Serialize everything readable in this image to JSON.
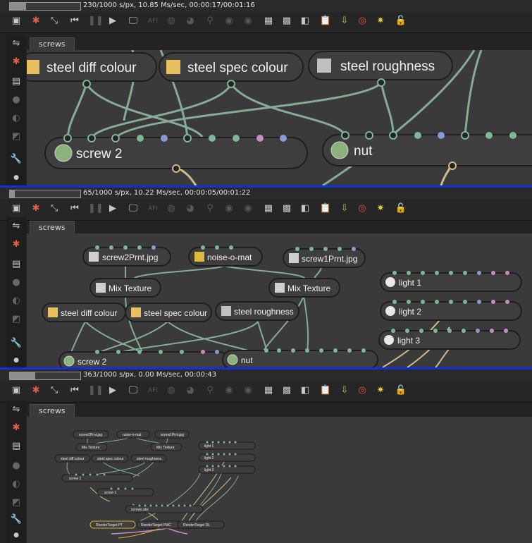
{
  "panels": [
    {
      "status": {
        "progress": 0.23,
        "text": "230/1000 s/px, 10.85 Ms/sec, 00:00:17/00:01:16"
      },
      "tab": "screws",
      "nodes": [
        {
          "label": "steel diff colour",
          "icon": "texture-colour-icon"
        },
        {
          "label": "steel spec colour",
          "icon": "texture-colour-icon"
        },
        {
          "label": "steel roughness",
          "icon": "texture-greyscale-icon"
        },
        {
          "label": "screw 2",
          "icon": "mesh-sphere-icon"
        },
        {
          "label": "nut",
          "icon": "mesh-sphere-icon"
        }
      ]
    },
    {
      "status": {
        "progress": 0.065,
        "text": "65/1000 s/px, 10.22 Ms/sec, 00:00:05/00:01:22"
      },
      "tab": "screws",
      "nodes": [
        {
          "label": "screw2Prnt.jpg",
          "icon": "image-file-icon"
        },
        {
          "label": "noise-o-mat",
          "icon": "noise-warning-icon"
        },
        {
          "label": "screw1Prnt.jpg",
          "icon": "image-file-icon"
        },
        {
          "label": "Mix Texture",
          "icon": "mix-texture-icon"
        },
        {
          "label": "Mix Texture",
          "icon": "mix-texture-icon"
        },
        {
          "label": "steel diff colour",
          "icon": "texture-colour-icon"
        },
        {
          "label": "steel spec colour",
          "icon": "texture-colour-icon"
        },
        {
          "label": "steel roughness",
          "icon": "texture-greyscale-icon"
        },
        {
          "label": "screw 2",
          "icon": "mesh-sphere-icon"
        },
        {
          "label": "nut",
          "icon": "mesh-sphere-icon"
        },
        {
          "label": "light 1",
          "icon": "light-icon"
        },
        {
          "label": "light 2",
          "icon": "light-icon"
        },
        {
          "label": "light 3",
          "icon": "light-icon"
        }
      ]
    },
    {
      "status": {
        "progress": 0.363,
        "text": "363/1000 s/px, 0.00 Ms/sec, 00:00:43"
      },
      "tab": "screws",
      "nodes": [
        {
          "label": "screw2Prnt.jpg"
        },
        {
          "label": "noise-o-mat"
        },
        {
          "label": "screw1Prnt.jpg"
        },
        {
          "label": "Mix Texture"
        },
        {
          "label": "Mix Texture"
        },
        {
          "label": "steel diff colour"
        },
        {
          "label": "steel spec colour"
        },
        {
          "label": "steel roughness"
        },
        {
          "label": "screw 2"
        },
        {
          "label": "screw 1"
        },
        {
          "label": "light 1"
        },
        {
          "label": "light 2"
        },
        {
          "label": "light 3"
        },
        {
          "label": "screws.abc"
        },
        {
          "label": "RenderTarget PT"
        },
        {
          "label": "RenderTarget PMC"
        },
        {
          "label": "RenderTarget DL"
        }
      ]
    }
  ],
  "colors": {
    "wire": "#8fb8a0",
    "wire_render": "#cdbd8a",
    "node_fill": "#3e3e3e",
    "node_stroke": "#1f1f1f",
    "pin_green": "#7fb796",
    "pin_blue": "#8a9ad0",
    "pin_pink": "#c690c4",
    "separator": "#1030e0"
  }
}
